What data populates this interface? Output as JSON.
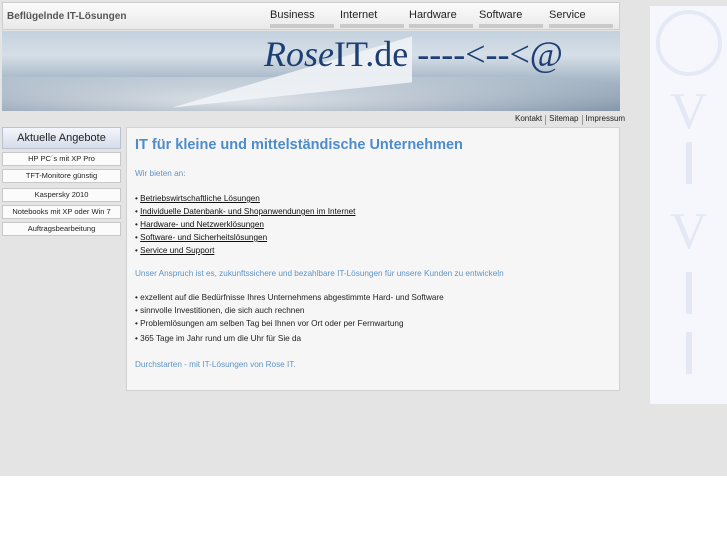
{
  "header": {
    "slogan": "Beflügelnde IT-Lösungen",
    "nav": [
      "Business",
      "Internet",
      "Hardware",
      "Software",
      "Service"
    ]
  },
  "banner": {
    "title_italic": "Rose",
    "title_rest": "IT.de ----<--<@"
  },
  "toplinks": [
    "Kontakt",
    "Sitemap",
    "Impressum"
  ],
  "sidebar": {
    "heading": "Aktuelle Angebote",
    "items": [
      "HP PC´s mit XP Pro",
      "TFT-Monitore günstig",
      "Kaspersky 2010",
      "Notebooks mit XP oder Win 7",
      "Auftragsbearbeitung"
    ]
  },
  "content": {
    "heading": "IT für kleine und mittelständische Unternehmen",
    "intro": "Wir bieten an:",
    "offers": [
      "Betriebswirtschaftliche Lösungen",
      "Individuelle Datenbank- und Shopanwendungen im Internet",
      "Hardware- und Netzwerklösungen",
      "Software- und Sicherheitslösungen",
      "Service und Support"
    ],
    "claim": "Unser Anspruch ist es, zukunftssichere und bezahlbare IT-Lösungen für unsere Kunden zu entwickeln",
    "benefits": [
      "exzellent auf die Bedürfnisse Ihres Unternehmens abgestimmte Hard- und Software",
      "sinnvolle Investitionen, die sich auch rechnen",
      "Problemlösungen am selben Tag bei Ihnen vor Ort oder per Fernwartung",
      "365 Tage im Jahr rund um die Uhr für Sie da"
    ],
    "closing": "Durchstarten - mit IT-Lösungen von Rose IT.",
    "bullet": "• "
  },
  "colors": {
    "heading_blue": "#4d8ccc",
    "text_blue": "#5f93c6",
    "banner_title": "#1e3f74"
  }
}
